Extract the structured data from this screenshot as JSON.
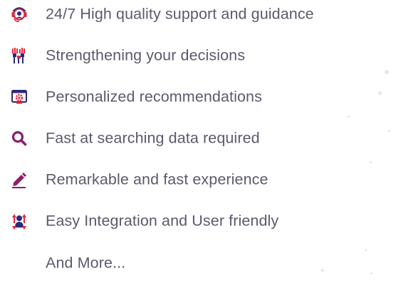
{
  "features": {
    "items": [
      {
        "label": "24/7 High quality support and guidance",
        "icon": "support-headset-icon"
      },
      {
        "label": "Strengthening your decisions",
        "icon": "raised-hands-icon"
      },
      {
        "label": "Personalized recommendations",
        "icon": "settings-screen-icon"
      },
      {
        "label": "Fast at searching data required",
        "icon": "search-icon"
      },
      {
        "label": "Remarkable and fast experience",
        "icon": "pencil-icon"
      },
      {
        "label": "Easy Integration and User friendly",
        "icon": "user-integration-icon"
      },
      {
        "label": "And More..."
      }
    ]
  },
  "colors": {
    "text": "#5d5a6b",
    "icon_red": "#e2263a",
    "icon_navy": "#2b2a7a",
    "icon_purple": "#8a1f6d"
  }
}
